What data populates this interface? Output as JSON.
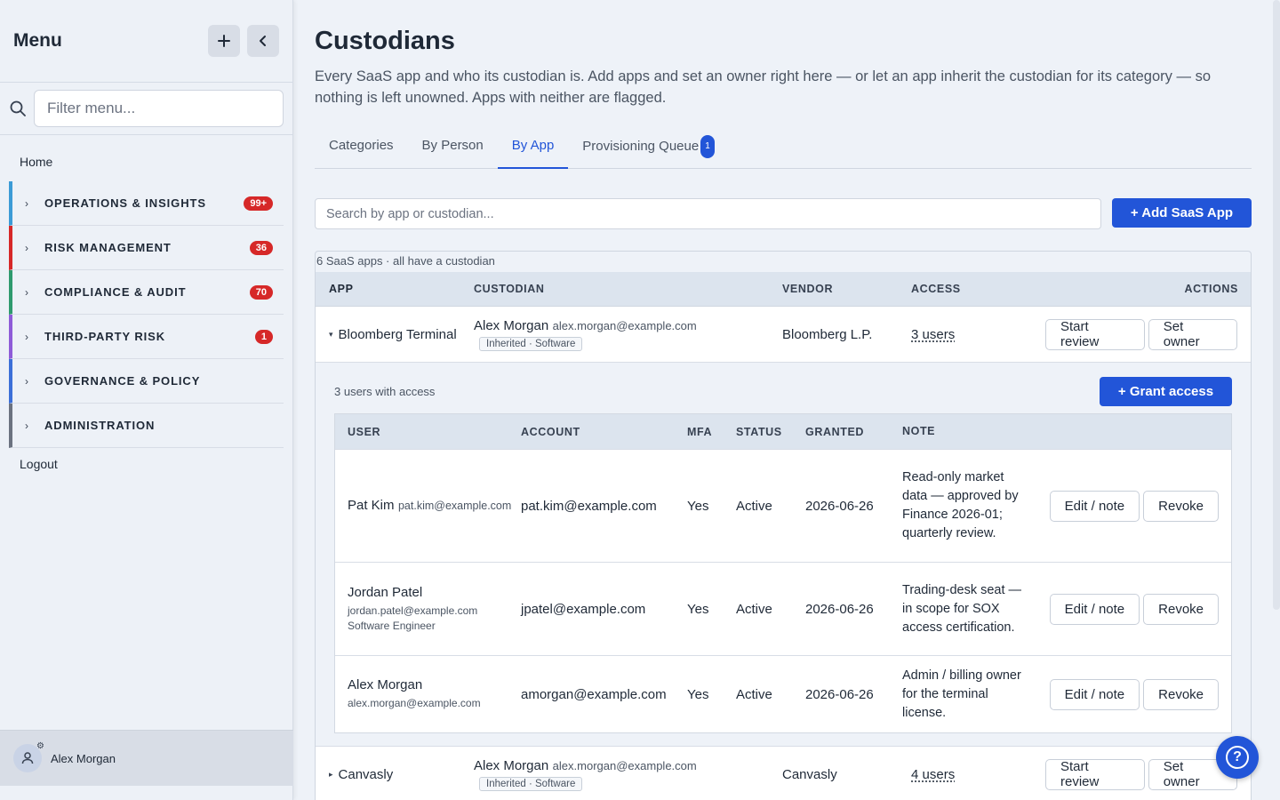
{
  "sidebar": {
    "title": "Menu",
    "add_icon": "plus-icon",
    "collapse_icon": "chevron-left-icon",
    "filter_placeholder": "Filter menu...",
    "home": "Home",
    "groups": [
      {
        "label": "OPERATIONS & INSIGHTS",
        "badge": "99+",
        "color": "#3b9bd6"
      },
      {
        "label": "RISK MANAGEMENT",
        "badge": "36",
        "color": "#d62828"
      },
      {
        "label": "COMPLIANCE & AUDIT",
        "badge": "70",
        "color": "#2e9a6e"
      },
      {
        "label": "THIRD-PARTY RISK",
        "badge": "1",
        "color": "#8e5bd8"
      },
      {
        "label": "GOVERNANCE & POLICY",
        "badge": "",
        "color": "#3b6fd8"
      },
      {
        "label": "ADMINISTRATION",
        "badge": "",
        "color": "#6b7280"
      }
    ],
    "logout": "Logout",
    "user_name": "Alex Morgan"
  },
  "page": {
    "title": "Custodians",
    "description": "Every SaaS app and who its custodian is. Add apps and set an owner right here — or let an app inherit the custodian for its category — so nothing is left unowned. Apps with neither are flagged."
  },
  "tabs": [
    {
      "label": "Categories",
      "active": false
    },
    {
      "label": "By Person",
      "active": false
    },
    {
      "label": "By App",
      "active": true
    },
    {
      "label": "Provisioning Queue",
      "badge": "1",
      "active": false
    }
  ],
  "search": {
    "placeholder": "Search by app or custodian..."
  },
  "add_app_label": "+ Add SaaS App",
  "summary": "6 SaaS apps · all have a custodian",
  "table_headers": {
    "app": "APP",
    "custodian": "CUSTODIAN",
    "vendor": "VENDOR",
    "access": "ACCESS",
    "actions": "ACTIONS"
  },
  "apps": [
    {
      "caret": "▾",
      "name": "Bloomberg Terminal",
      "custodian_name": "Alex Morgan",
      "custodian_email": "alex.morgan@example.com",
      "tag": "Inherited · Software",
      "vendor": "Bloomberg L.P.",
      "access": "3 users",
      "review_label": "Start review",
      "owner_label": "Set owner"
    },
    {
      "caret": "▸",
      "name": "Canvasly",
      "custodian_name": "Alex Morgan",
      "custodian_email": "alex.morgan@example.com",
      "tag": "Inherited · Software",
      "vendor": "Canvasly",
      "access": "4 users",
      "review_label": "Start review",
      "owner_label": "Set owner"
    }
  ],
  "expanded": {
    "count": "3 users with access",
    "grant_label": "+ Grant access",
    "headers": {
      "user": "USER",
      "account": "ACCOUNT",
      "mfa": "MFA",
      "status": "STATUS",
      "granted": "GRANTED",
      "note": "NOTE"
    },
    "users": [
      {
        "name": "Pat Kim",
        "email": "pat.kim@example.com",
        "subtitle": "",
        "account": "pat.kim@example.com",
        "mfa": "Yes",
        "status": "Active",
        "granted": "2026-06-26",
        "note": "Read-only market data — approved by Finance 2026-01; quarterly review.",
        "edit_label": "Edit / note",
        "revoke_label": "Revoke"
      },
      {
        "name": "Jordan Patel",
        "email": "jordan.patel@example.com",
        "subtitle": "Software Engineer",
        "account": "jpatel@example.com",
        "mfa": "Yes",
        "status": "Active",
        "granted": "2026-06-26",
        "note": "Trading-desk seat — in scope for SOX access certification.",
        "edit_label": "Edit / note",
        "revoke_label": "Revoke"
      },
      {
        "name": "Alex Morgan",
        "email": "alex.morgan@example.com",
        "subtitle": "",
        "account": "amorgan@example.com",
        "mfa": "Yes",
        "status": "Active",
        "granted": "2026-06-26",
        "note": "Admin / billing owner for the terminal license.",
        "edit_label": "Edit / note",
        "revoke_label": "Revoke"
      }
    ]
  },
  "help_icon": "help-circle-icon"
}
